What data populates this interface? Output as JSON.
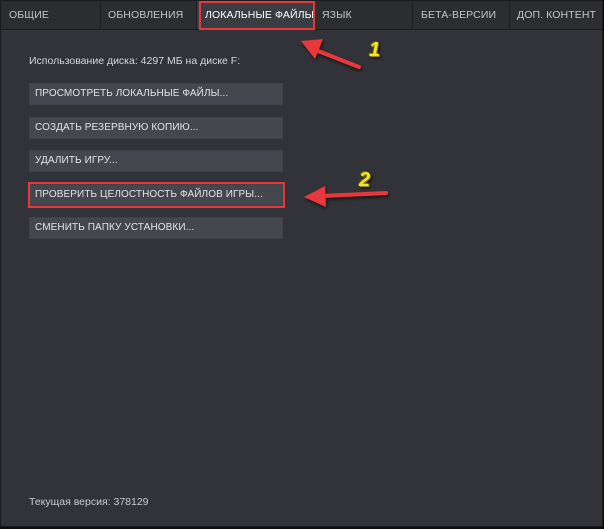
{
  "tabs": [
    {
      "label": "ОБЩИЕ"
    },
    {
      "label": "ОБНОВЛЕНИЯ"
    },
    {
      "label": "ЛОКАЛЬНЫЕ ФАЙЛЫ"
    },
    {
      "label": "ЯЗЫК"
    },
    {
      "label": "БЕТА-ВЕРСИИ"
    },
    {
      "label": "ДОП. КОНТЕНТ"
    }
  ],
  "active_tab": "ЛОКАЛЬНЫЕ ФАЙЛЫ",
  "disk_usage": "Использование диска: 4297 МБ на диске F:",
  "buttons": [
    {
      "label": "ПРОСМОТРЕТЬ ЛОКАЛЬНЫЕ ФАЙЛЫ..."
    },
    {
      "label": "СОЗДАТЬ РЕЗЕРВНУЮ КОПИЮ..."
    },
    {
      "label": "УДАЛИТЬ ИГРУ..."
    },
    {
      "label": "ПРОВЕРИТЬ ЦЕЛОСТНОСТЬ ФАЙЛОВ ИГРЫ..."
    },
    {
      "label": "СМЕНИТЬ ПАПКУ УСТАНОВКИ..."
    }
  ],
  "annotations": {
    "step1": "1",
    "step2": "2"
  },
  "current_version": "Текущая версия: 378129",
  "colors": {
    "highlight": "#e8373b",
    "badge": "#f3e62a",
    "background": "#313338"
  }
}
